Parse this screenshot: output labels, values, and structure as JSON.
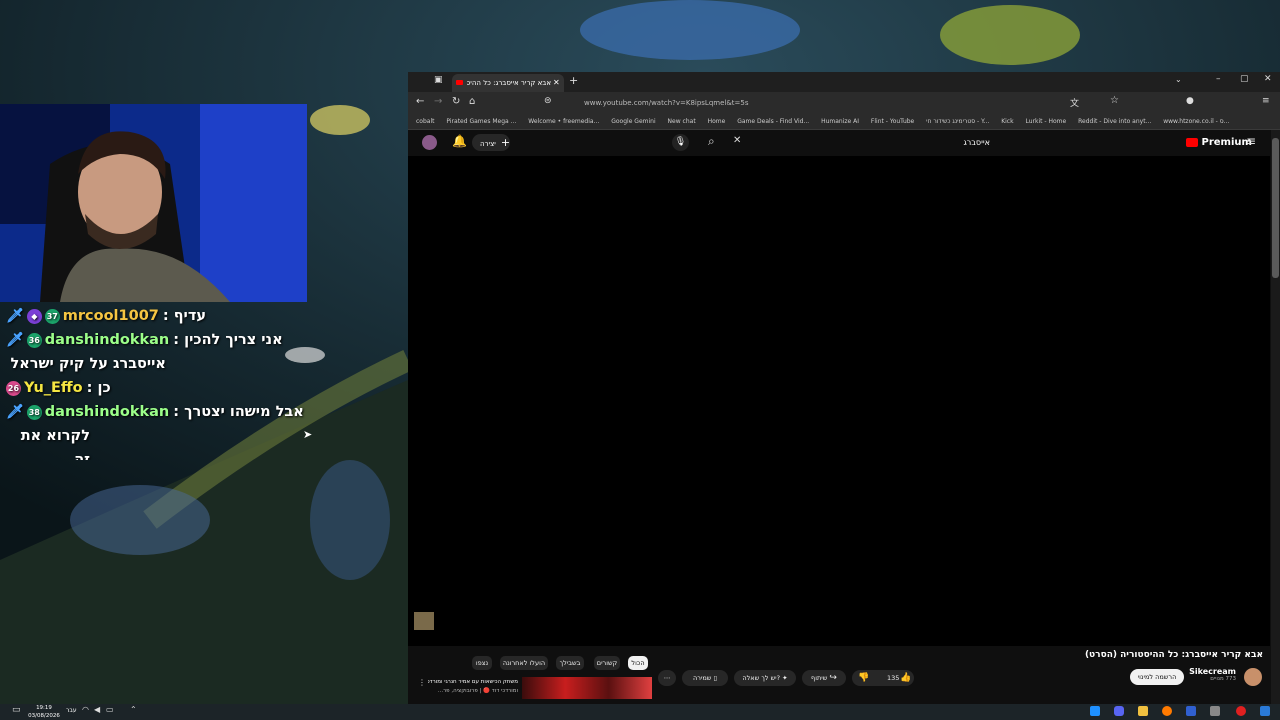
{
  "chat": {
    "messages": [
      {
        "user": "mrcool1007",
        "text": "עדיף",
        "badge_num": "37",
        "user_color": "#f5c542",
        "num_color": "#1ba36a"
      },
      {
        "user": "danshindokkan",
        "text": "אני צריך להכין",
        "cont": "אייסברג על קיק ישראל",
        "badge_num": "36",
        "user_color": "#9cff8a",
        "num_color": "#1ba36a"
      },
      {
        "user": "Yu_Effo",
        "text": "כן",
        "badge_num": "26",
        "user_color": "#f5e642",
        "num_color": "#d94a8c"
      },
      {
        "user": "danshindokkan",
        "text": "אבל מישהו יצטרך",
        "cont": "לקרוא את זה",
        "badge_num": "38",
        "user_color": "#9cff8a",
        "num_color": "#1ba36a"
      }
    ]
  },
  "browser": {
    "tab_title": "אבא קריר אייסברג: כל ההיסטו",
    "url": "www.youtube.com/watch?v=K8ipsLqmel&t=5s",
    "bookmarks": [
      "cobalt",
      "Pirated Games Mega ...",
      "Welcome • freemedia...",
      "Google Gemini",
      "New chat",
      "Home",
      "Game Deals - Find Vid...",
      "Humanize AI",
      "Flint - YouTube",
      "סטרימינג כשידור חי - Y...",
      "Kick",
      "Lurkit - Home",
      "Reddit - Dive into anyt...",
      "www.htzone.co.il - ס..."
    ]
  },
  "youtube": {
    "search_value": "אייסברג",
    "create_label": "יצירה",
    "premium_label": "Premium",
    "video_title": "אבא קריר אייסברג: כל ההיסטוריה (הסרט)",
    "channel_name": "Sikecream",
    "subscribers": "773 מנויים",
    "subscribe_label": "הרשמה למינוי",
    "likes": "135",
    "share_label": "שיתוף",
    "ask_label": "יש לך שאלה?",
    "save_label": "שמירה",
    "chips": [
      "הכול",
      "קשורים",
      "בשבילך",
      "הועלו לאחרונה",
      "נצפו"
    ],
    "rec_title": "משחק הכישאות עם אמיר חנרגי ומורדכי דוד | פרובוקציה, פר...",
    "rec_channel": "ומורדכי דוד 🔴 | פרובוקציה, פר..."
  },
  "taskbar": {
    "time": "19:19",
    "date": "03/08/2026",
    "lang": "עבר"
  },
  "colors": {
    "yt_red": "#ff0000",
    "chip_active": "#f1f1f1"
  }
}
